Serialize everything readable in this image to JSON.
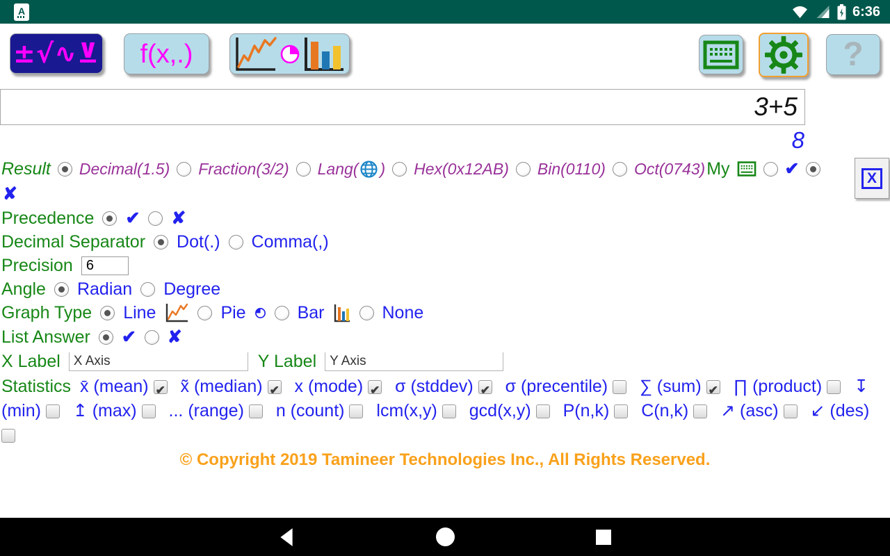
{
  "status_bar": {
    "time": "6:36",
    "app_icon_letter": "A"
  },
  "icons": {
    "wifi": "wifi-fan",
    "signal": "signal-triangle",
    "battery": "battery-charging",
    "globe": "blue-globe",
    "keyboard": "green-keyboard",
    "gear": "green-gear",
    "line_chart": "orange-line-chart",
    "pie_chart": "pie-quarter",
    "bar_chart": "tri-color-bars",
    "back": "◀",
    "home": "●",
    "recents": "■"
  },
  "colors": {
    "statusbar": "#00584C",
    "navy_button": "#191991",
    "light_button": "#B6DCE9",
    "green_label": "#178717",
    "blue_option": "#2222EE",
    "purple_option": "#993299",
    "magenta": "#FF00FF",
    "copyright_orange": "#F9A11B",
    "gear_outline": "#F0A030"
  },
  "toolbar": {
    "math_button": "±√∿⊻",
    "fx_button": "f(x,.)",
    "help_button": "?"
  },
  "calculator": {
    "expression": "3+5",
    "result": "8"
  },
  "settings": {
    "close_button": "X",
    "result": {
      "label": "Result",
      "decimal": "Decimal(1.5)",
      "fraction": "Fraction(3/2)",
      "lang_open": "Lang(",
      "lang_close": ")",
      "hex": "Hex(0x12AB)",
      "bin": "Bin(0110)",
      "oct": "Oct(0743)",
      "my": "My",
      "yes": "✔",
      "no": "✘",
      "sel": {
        "decimal": true,
        "fraction": false,
        "lang": false,
        "hex": false,
        "bin": false,
        "oct": false,
        "my_yes": false,
        "my_no": true
      }
    },
    "precedence": {
      "label": "Precedence",
      "yes": "✔",
      "no": "✘",
      "sel_yes": true,
      "sel_no": false
    },
    "separator": {
      "label": "Decimal Separator",
      "dot": "Dot(.)",
      "comma": "Comma(,)",
      "sel_dot": true,
      "sel_comma": false
    },
    "precision": {
      "label": "Precision",
      "value": "6"
    },
    "angle": {
      "label": "Angle",
      "radian": "Radian",
      "degree": "Degree",
      "sel_radian": true,
      "sel_degree": false
    },
    "graph_type": {
      "label": "Graph Type",
      "line": "Line",
      "pie": "Pie",
      "bar": "Bar",
      "none": "None",
      "sel_line": true,
      "sel_pie": false,
      "sel_bar": false,
      "sel_none": false
    },
    "list_answer": {
      "label": "List Answer",
      "yes": "✔",
      "no": "✘",
      "sel_yes": true,
      "sel_no": false
    },
    "axis_labels": {
      "x_label": "X Label",
      "x_value": "X Axis",
      "y_label": "Y Label",
      "y_value": "Y Axis"
    }
  },
  "statistics": {
    "label": "Statistics",
    "items": [
      {
        "label": "x̄ (mean)",
        "checked": true
      },
      {
        "label": "x̃ (median)",
        "checked": true
      },
      {
        "label": "x (mode)",
        "checked": true
      },
      {
        "label": "σ (stddev)",
        "checked": true
      },
      {
        "label": "σ (precentile)",
        "checked": false
      },
      {
        "label": "∑ (sum)",
        "checked": true
      },
      {
        "label": "∏ (product)",
        "checked": false
      },
      {
        "label": "↧ (min)",
        "checked": false
      },
      {
        "label": "↥ (max)",
        "checked": false
      },
      {
        "label": "... (range)",
        "checked": false
      },
      {
        "label": "n (count)",
        "checked": false
      },
      {
        "label": "lcm(x,y)",
        "checked": false
      },
      {
        "label": "gcd(x,y)",
        "checked": false
      },
      {
        "label": "P(n,k)",
        "checked": false
      },
      {
        "label": "C(n,k)",
        "checked": false
      },
      {
        "label": "↗ (asc)",
        "checked": false
      },
      {
        "label": "↙ (des)",
        "checked": false
      }
    ]
  },
  "footer": {
    "copyright": "© Copyright 2019 Tamineer Technologies Inc., All Rights Reserved."
  }
}
